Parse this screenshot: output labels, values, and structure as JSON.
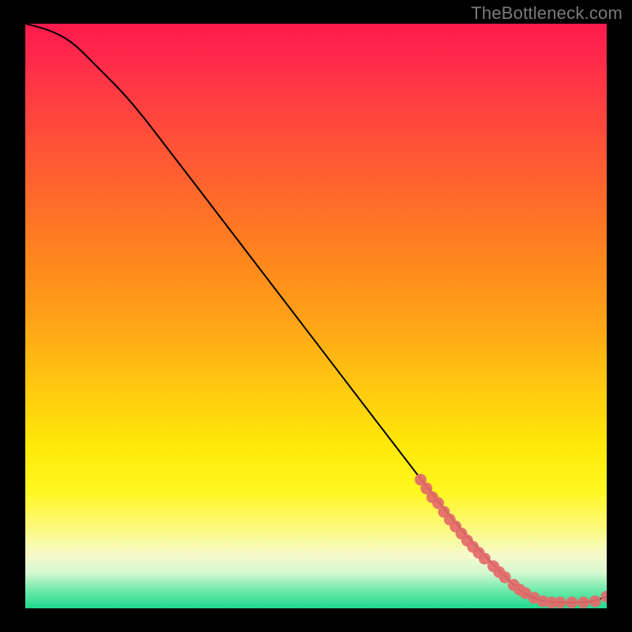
{
  "watermark": "TheBottleneck.com",
  "chart_data": {
    "type": "line",
    "title": "",
    "xlabel": "",
    "ylabel": "",
    "xlim": [
      0,
      100
    ],
    "ylim": [
      0,
      100
    ],
    "series": [
      {
        "name": "bottleneck-curve",
        "x": [
          0,
          4,
          8,
          12,
          18,
          25,
          35,
          45,
          55,
          65,
          72,
          78,
          82,
          85,
          88,
          91,
          94,
          97,
          100
        ],
        "y": [
          100,
          99,
          97,
          93,
          87,
          78,
          65,
          52,
          39,
          26,
          17,
          10,
          6,
          3,
          1.5,
          1,
          1,
          1,
          2
        ]
      }
    ],
    "markers": {
      "name": "sample-points",
      "color": "#e46a6a",
      "points": [
        {
          "x": 68,
          "y": 22
        },
        {
          "x": 69,
          "y": 20.5
        },
        {
          "x": 70,
          "y": 19
        },
        {
          "x": 71,
          "y": 18
        },
        {
          "x": 72,
          "y": 16.5
        },
        {
          "x": 73,
          "y": 15.2
        },
        {
          "x": 74,
          "y": 14
        },
        {
          "x": 75,
          "y": 12.8
        },
        {
          "x": 76,
          "y": 11.6
        },
        {
          "x": 77,
          "y": 10.5
        },
        {
          "x": 78,
          "y": 9.5
        },
        {
          "x": 79,
          "y": 8.5
        },
        {
          "x": 80.5,
          "y": 7.2
        },
        {
          "x": 81.5,
          "y": 6.2
        },
        {
          "x": 82.5,
          "y": 5.3
        },
        {
          "x": 84,
          "y": 4.0
        },
        {
          "x": 85,
          "y": 3.2
        },
        {
          "x": 86,
          "y": 2.6
        },
        {
          "x": 87.5,
          "y": 1.8
        },
        {
          "x": 89,
          "y": 1.2
        },
        {
          "x": 90.5,
          "y": 1.0
        },
        {
          "x": 92,
          "y": 1.0
        },
        {
          "x": 94,
          "y": 1.0
        },
        {
          "x": 96,
          "y": 1.0
        },
        {
          "x": 98,
          "y": 1.2
        },
        {
          "x": 100,
          "y": 2.0
        }
      ]
    },
    "gradient_stops": [
      {
        "pos": 0,
        "color": "#ff1a4d"
      },
      {
        "pos": 50,
        "color": "#ffa018"
      },
      {
        "pos": 80,
        "color": "#fff820"
      },
      {
        "pos": 97,
        "color": "#6ce9a8"
      },
      {
        "pos": 100,
        "color": "#1fd98f"
      }
    ]
  }
}
